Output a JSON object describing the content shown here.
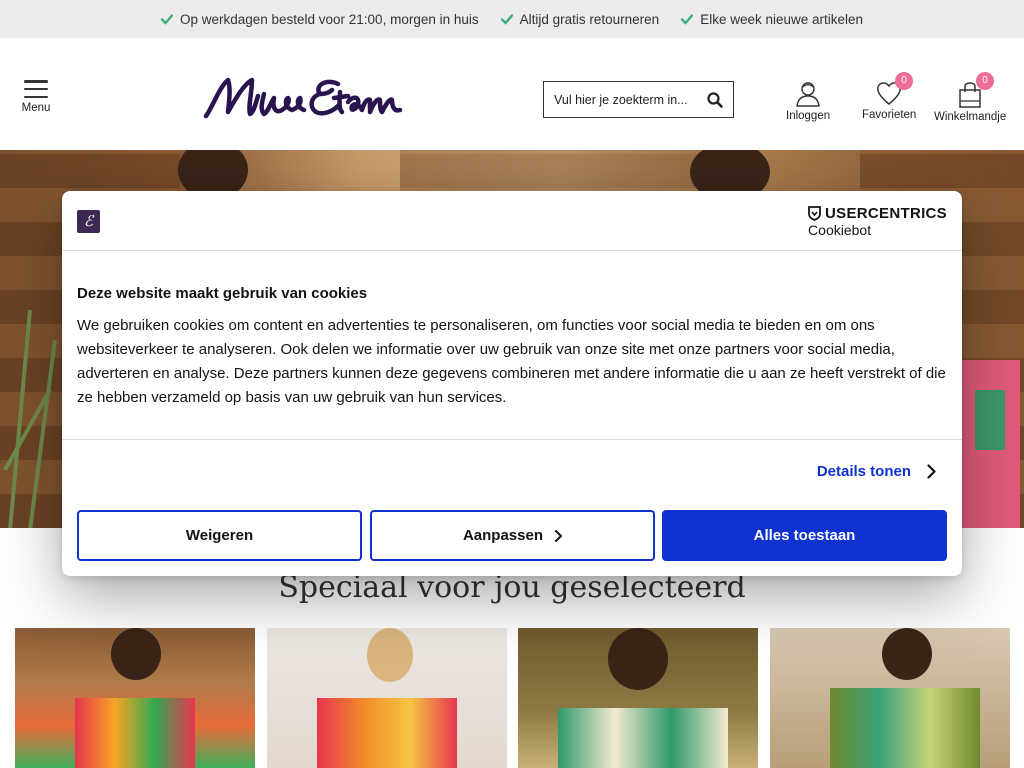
{
  "usp": {
    "items": [
      "Op werkdagen besteld voor 21:00, morgen in huis",
      "Altijd gratis retourneren",
      "Elke week nieuwe artikelen"
    ],
    "check_color": "#3bb07a"
  },
  "header": {
    "menu_label": "Menu",
    "logo_text": "Miss Etam",
    "search_placeholder": "Vul hier je zoekterm in...",
    "login_label": "Inloggen",
    "favorites_label": "Favorieten",
    "favorites_count": "0",
    "cart_label": "Winkelmandje",
    "cart_count": "0"
  },
  "section": {
    "title": "Speciaal voor jou geselecteerd"
  },
  "cookie_dialog": {
    "brand_top": "USERCENTRICS",
    "brand_sub": "Cookiebot",
    "title": "Deze website maakt gebruik van cookies",
    "text": "We gebruiken cookies om content en advertenties te personaliseren, om functies voor social media te bieden en om ons websiteverkeer te analyseren. Ook delen we informatie over uw gebruik van onze site met onze partners voor social media, adverteren en analyse. Deze partners kunnen deze gegevens combineren met andere informatie die u aan ze heeft verstrekt of die ze hebben verzameld op basis van uw gebruik van hun services.",
    "details_label": "Details tonen",
    "deny_label": "Weigeren",
    "customize_label": "Aanpassen",
    "allow_label": "Alles toestaan",
    "accent_color": "#1032cf"
  },
  "colors": {
    "brand_purple": "#2a1450",
    "badge_pink": "#ec6d99"
  }
}
